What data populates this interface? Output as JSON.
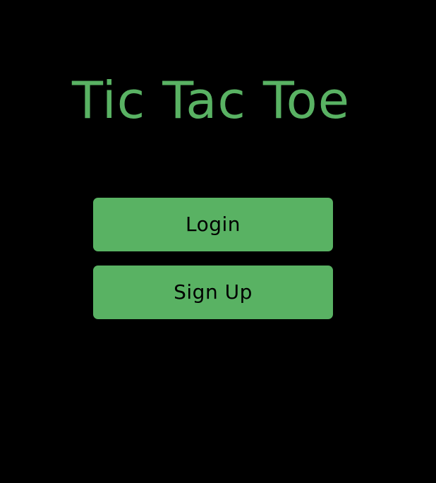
{
  "app": {
    "title": "Tic Tac Toe"
  },
  "actions": {
    "login_label": "Login",
    "signup_label": "Sign Up"
  },
  "colors": {
    "background": "#000000",
    "accent": "#59b263",
    "button_text": "#000000"
  }
}
